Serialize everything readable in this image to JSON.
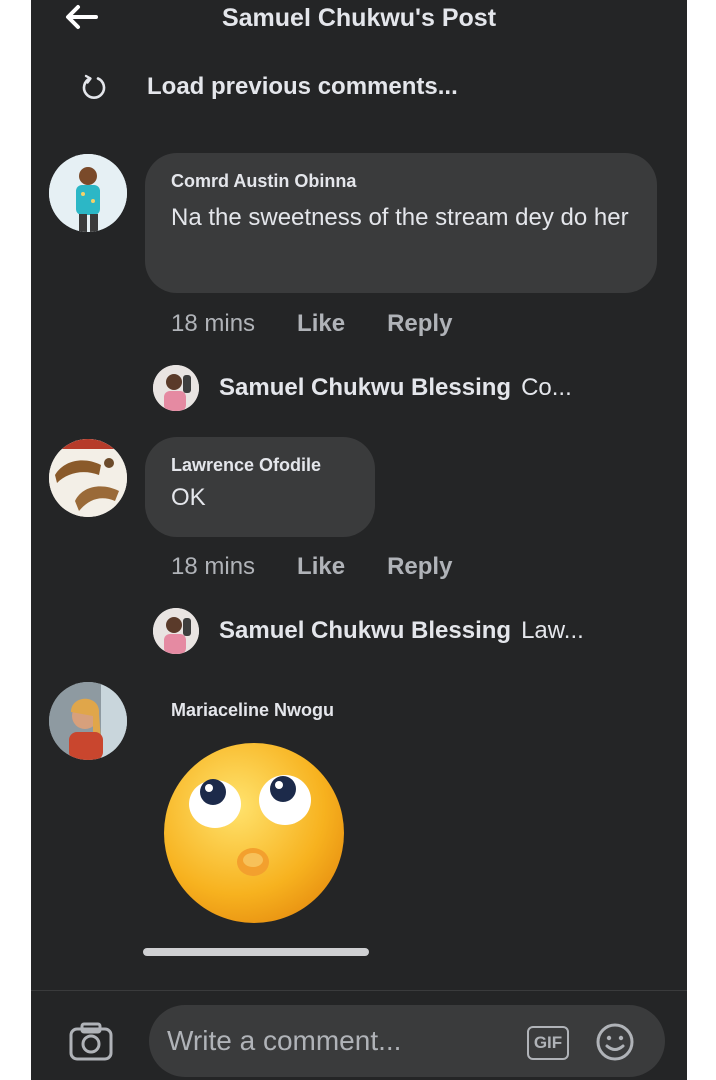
{
  "header": {
    "title": "Samuel Chukwu's Post",
    "back_icon": "back-arrow-icon"
  },
  "load_previous": {
    "label": "Load previous comments...",
    "icon": "refresh-icon"
  },
  "comments": [
    {
      "author": "Comrd Austin Obinna",
      "text": "Na the sweetness of the stream dey do her",
      "time": "18 mins",
      "like_label": "Like",
      "reply_label": "Reply",
      "reply_preview": {
        "name": "Samuel Chukwu Blessing",
        "text": "Co..."
      }
    },
    {
      "author": "Lawrence Ofodile",
      "text": "OK",
      "time": "18 mins",
      "like_label": "Like",
      "reply_label": "Reply",
      "reply_preview": {
        "name": "Samuel Chukwu Blessing",
        "text": "Law..."
      }
    },
    {
      "author": "Mariaceline Nwogu",
      "sticker": "eye-roll-emoji"
    }
  ],
  "composer": {
    "placeholder": "Write a comment...",
    "gif_label": "GIF",
    "camera_icon": "camera-icon",
    "emoji_icon": "smiley-icon"
  },
  "colors": {
    "background": "#242526",
    "bubble": "#3a3b3c",
    "text": "#e4e6eb",
    "muted": "#b0b3b8"
  }
}
